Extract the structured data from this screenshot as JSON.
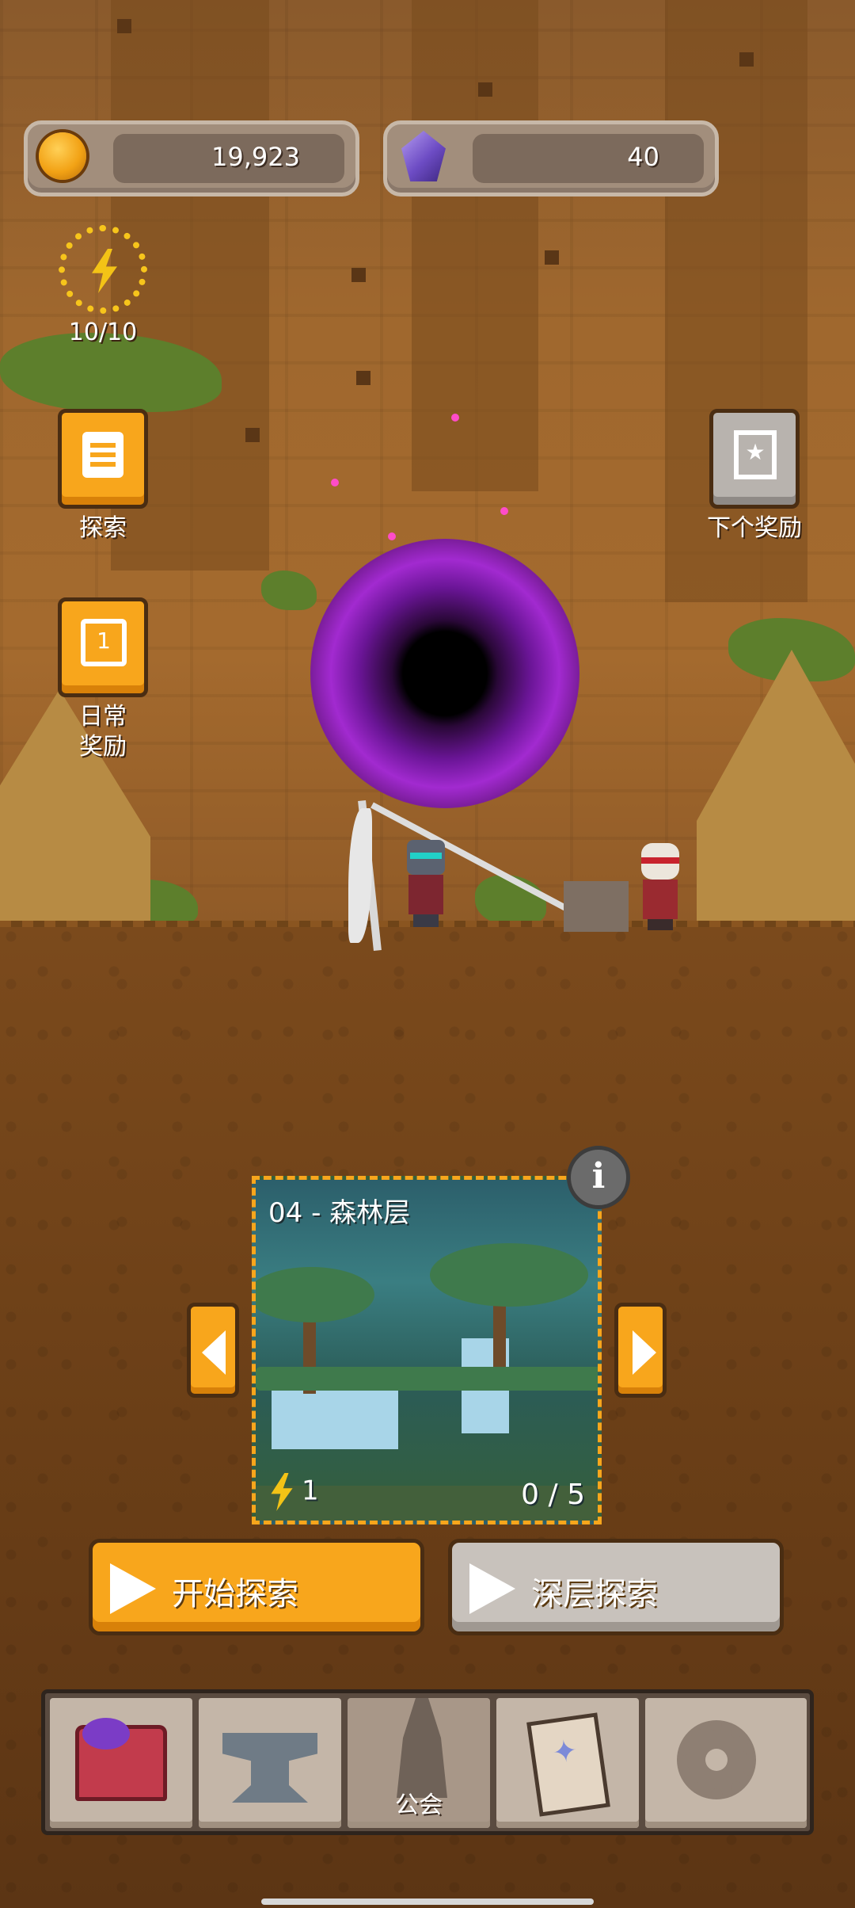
{
  "currencies": {
    "gold": {
      "icon": "gold-coin-icon",
      "value": "19,923"
    },
    "gems": {
      "icon": "purple-gem-icon",
      "value": "40"
    }
  },
  "energy": {
    "icon": "lightning-bolt-icon",
    "value": "10/10"
  },
  "side_buttons": {
    "explore": {
      "label": "探索",
      "icon": "document-icon"
    },
    "daily_reward": {
      "label": "日常\n奖励",
      "icon": "calendar-icon"
    },
    "next_reward": {
      "label": "下个奖励",
      "icon": "star-card-icon"
    }
  },
  "stage": {
    "title": "04 - 森林层",
    "cost": "1",
    "progress": "0 / 5"
  },
  "actions": {
    "start_explore": "开始探索",
    "deep_explore": "深层探索"
  },
  "nav": {
    "items": [
      {
        "icon": "treasure-chest-icon",
        "label": ""
      },
      {
        "icon": "anvil-icon",
        "label": ""
      },
      {
        "icon": "guild-tower-icon",
        "label": "公会"
      },
      {
        "icon": "scroll-card-icon",
        "label": ""
      },
      {
        "icon": "gear-icon",
        "label": ""
      }
    ]
  },
  "colors": {
    "accent_orange": "#f8a61c",
    "energy_yellow": "#f7c51b",
    "portal_purple": "#a22ad0"
  }
}
